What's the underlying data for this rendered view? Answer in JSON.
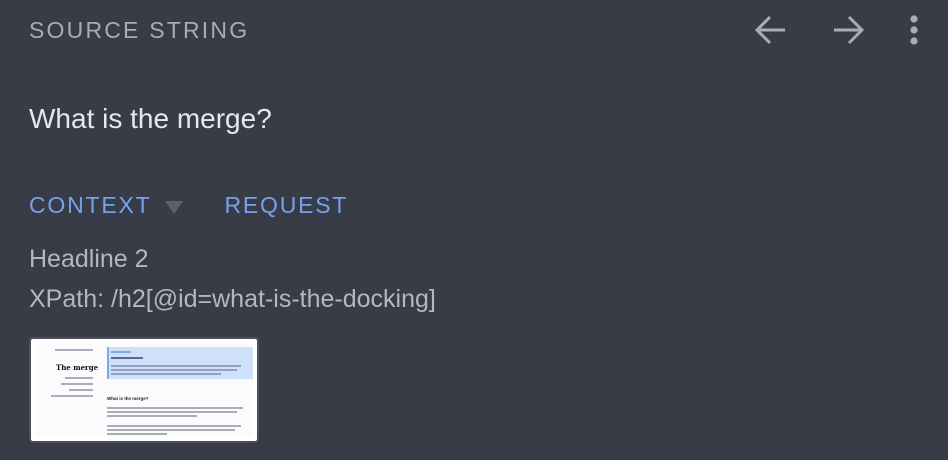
{
  "header": {
    "title": "SOURCE STRING",
    "back_icon": "arrow-left-icon",
    "forward_icon": "arrow-right-icon",
    "more_icon": "more-vert-icon"
  },
  "source": {
    "text": "What is the merge?"
  },
  "tabs": [
    {
      "label": "CONTEXT"
    },
    {
      "label": "REQUEST"
    }
  ],
  "context": {
    "element_type": "Headline 2",
    "xpath": "XPath: /h2[@id=what-is-the-docking]"
  },
  "screenshot": {
    "page_heading": "The merge",
    "section_heading": "What is the merge?"
  },
  "colors": {
    "background": "#373c47",
    "tab_accent": "#76a1ec",
    "muted_text": "#a8acb3"
  }
}
